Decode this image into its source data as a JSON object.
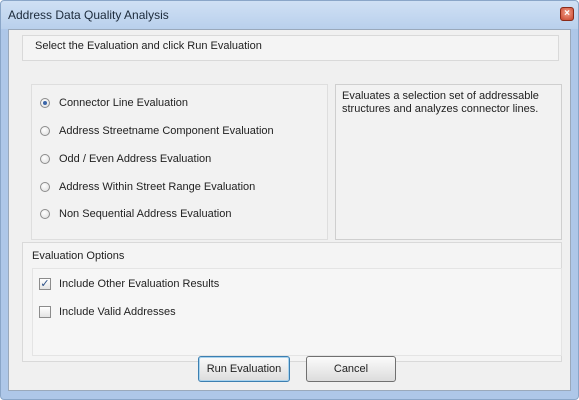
{
  "window": {
    "title": "Address Data Quality Analysis",
    "close_glyph": "×"
  },
  "instructions": "Select the Evaluation and click Run Evaluation",
  "evaluations": [
    {
      "label": "Connector Line Evaluation",
      "selected": true
    },
    {
      "label": "Address Streetname Component Evaluation",
      "selected": false
    },
    {
      "label": "Odd / Even Address Evaluation",
      "selected": false
    },
    {
      "label": "Address Within Street Range Evaluation",
      "selected": false
    },
    {
      "label": "Non Sequential Address Evaluation",
      "selected": false
    }
  ],
  "description": "Evaluates a selection set of addressable structures and analyzes connector lines.",
  "evaluation_options": {
    "header": "Evaluation Options",
    "items": [
      {
        "label": "Include Other Evaluation Results",
        "checked": true
      },
      {
        "label": "Include Valid Addresses",
        "checked": false
      }
    ]
  },
  "buttons": {
    "run": "Run Evaluation",
    "cancel": "Cancel"
  },
  "colors": {
    "title_bar": "#b9d0ec",
    "dialog_bg": "#f0f0f0",
    "close_button": "#c8432b"
  }
}
